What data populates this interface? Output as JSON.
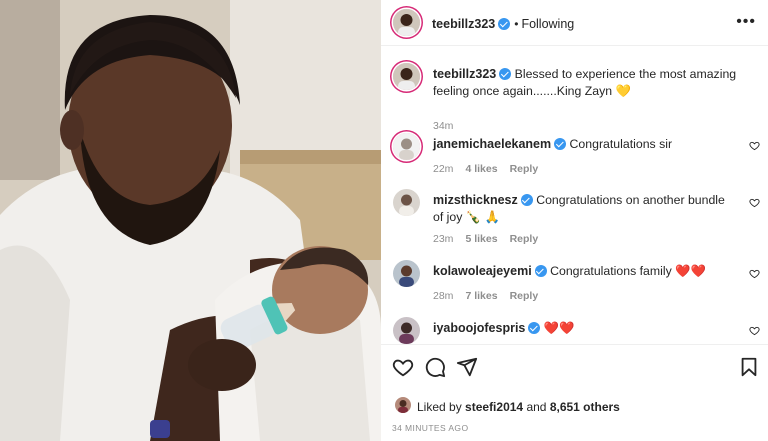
{
  "post": {
    "author": "teebillz323",
    "follow_status": "Following",
    "more_icon": "more-horizontal-icon",
    "caption": {
      "username": "teebillz323",
      "text": "Blessed to experience the most amazing feeling once again.......King Zayn",
      "emoji": "💛",
      "time": "34m"
    }
  },
  "comments": [
    {
      "username": "janemichaelekanem",
      "text": "Congratulations sir",
      "time": "22m",
      "likes": "4 likes",
      "reply": "Reply",
      "emoji": ""
    },
    {
      "username": "mizsthicknesz",
      "text": "Congratulations on another bundle of joy",
      "time": "23m",
      "likes": "5 likes",
      "reply": "Reply",
      "emoji": "🍾 🙏"
    },
    {
      "username": "kolawoleajeyemi",
      "text": "Congratulations family",
      "time": "28m",
      "likes": "7 likes",
      "reply": "Reply",
      "emoji": "❤️❤️"
    },
    {
      "username": "iyaboojofespris",
      "text": "",
      "time": "",
      "likes": "",
      "reply": "",
      "emoji": "❤️❤️"
    }
  ],
  "actions": {
    "like_icon": "heart-icon",
    "comment_icon": "comment-icon",
    "share_icon": "send-icon",
    "save_icon": "bookmark-icon"
  },
  "likes": {
    "prefix": "Liked by",
    "user": "steefi2014",
    "joiner": "and",
    "others": "8,651 others"
  },
  "timestamp": "34 MINUTES AGO",
  "colors": {
    "verified": "#3897f0",
    "heart": "#ed4956",
    "muted": "#8e8e8e"
  }
}
